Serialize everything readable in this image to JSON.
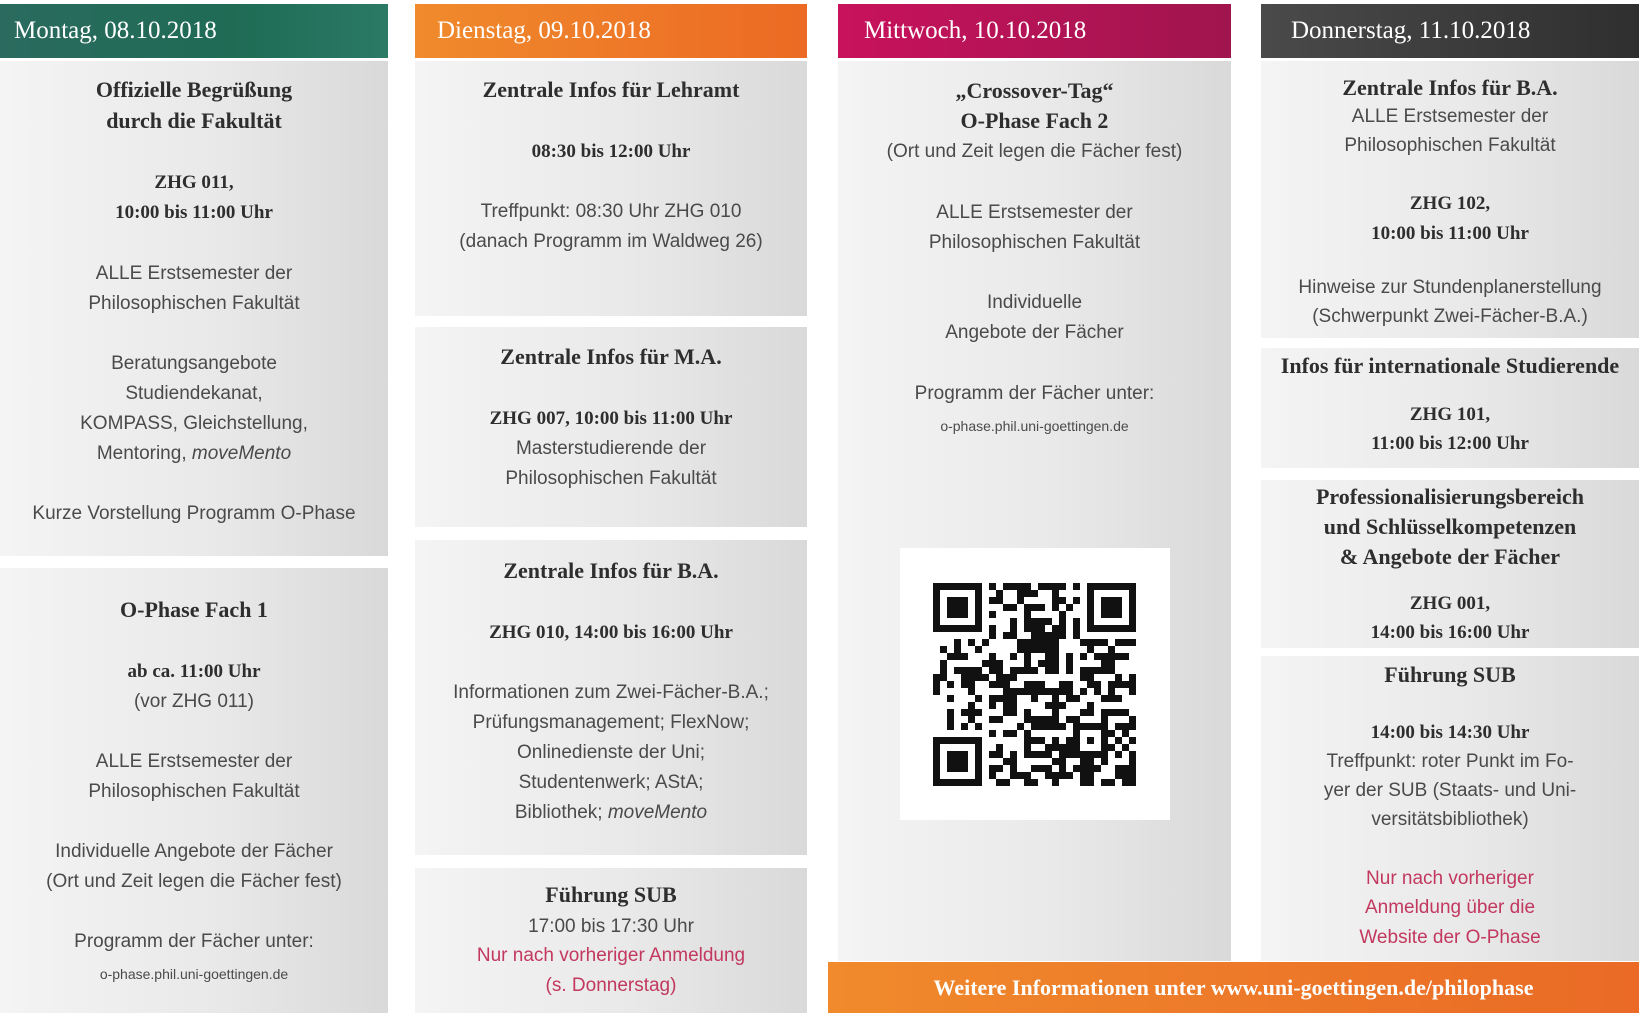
{
  "columns": {
    "mon": {
      "date": "Montag, 08.10.2018",
      "box1": {
        "l1": "Offizielle Begrüßung",
        "l2": "durch die Fakultät",
        "l3": "ZHG 011,",
        "l4": "10:00 bis 11:00 Uhr",
        "l5": "ALLE Erstsemester der",
        "l6": "Philosophischen Fakultät",
        "l7": "Beratungsangebote",
        "l8": "Studiendekanat,",
        "l9": "KOMPASS, Gleichstellung,",
        "l10a": "Mentoring, ",
        "l10b": "moveMento",
        "l11": "Kurze Vorstellung Programm O-Phase"
      },
      "box2": {
        "l1": "O-Phase Fach 1",
        "l2": "ab ca. 11:00 Uhr",
        "l3": "(vor ZHG 011)",
        "l4": "ALLE Erstsemester der",
        "l5": "Philosophischen Fakultät",
        "l6": "Individuelle Angebote der Fächer",
        "l7": "(Ort und Zeit legen die Fächer fest)",
        "l8": "Programm der Fächer unter:",
        "l9": "o-phase.phil.uni-goettingen.de"
      }
    },
    "tue": {
      "date": "Dienstag, 09.10.2018",
      "box1": {
        "l1": "Zentrale Infos für Lehramt",
        "l2": "08:30 bis 12:00 Uhr",
        "l3": "Treffpunkt: 08:30 Uhr ZHG 010",
        "l4": "(danach Programm im Waldweg 26)"
      },
      "box2": {
        "l1": "Zentrale Infos für M.A.",
        "l2": "ZHG 007, 10:00 bis 11:00 Uhr",
        "l3": "Masterstudierende der",
        "l4": "Philosophischen Fakultät"
      },
      "box3": {
        "l1": "Zentrale Infos für B.A.",
        "l2": "ZHG 010, 14:00 bis 16:00 Uhr",
        "l3": "Informationen zum Zwei-Fächer-B.A.;",
        "l4": "Prüfungsmanagement; FlexNow;",
        "l5": "Onlinedienste der Uni;",
        "l6": "Studentenwerk; AStA;",
        "l7a": "Bibliothek; ",
        "l7b": "moveMento"
      },
      "box4": {
        "l1": "Führung SUB",
        "l2": "17:00 bis 17:30 Uhr",
        "l3": "Nur nach vorheriger Anmeldung",
        "l4": "(s. Donnerstag)"
      }
    },
    "wed": {
      "date": "Mittwoch, 10.10.2018",
      "box1": {
        "l1": "„Crossover-Tag“",
        "l2": "O-Phase Fach 2",
        "l3": "(Ort und Zeit legen die Fächer fest)",
        "l4": "ALLE Erstsemester der",
        "l5": "Philosophischen Fakultät",
        "l6": "Individuelle",
        "l7": "Angebote der Fächer",
        "l8": "Programm der Fächer unter:",
        "l9": "o-phase.phil.uni-goettingen.de"
      }
    },
    "thu": {
      "date": "Donnerstag, 11.10.2018",
      "box1": {
        "l1": "Zentrale Infos für B.A.",
        "l2": "ALLE Erstsemester der",
        "l3": "Philosophischen Fakultät",
        "l4": "ZHG 102,",
        "l5": "10:00 bis 11:00 Uhr",
        "l6": "Hinweise zur Stundenplanerstellung",
        "l7": "(Schwerpunkt Zwei-Fächer-B.A.)"
      },
      "box2": {
        "l1": "Infos für internationale Studierende",
        "l2": "ZHG 101,",
        "l3": "11:00 bis 12:00 Uhr"
      },
      "box3": {
        "l1": "Professionalisierungsbereich",
        "l2": "und Schlüsselkompetenzen",
        "l3": "& Angebote der Fächer",
        "l4": "ZHG 001,",
        "l5": "14:00 bis 16:00 Uhr"
      },
      "box4": {
        "l1": "Führung SUB",
        "l2": "14:00 bis 14:30 Uhr",
        "l3": "Treffpunkt: roter Punkt im Fo-",
        "l4": "yer der SUB (Staats- und Uni-",
        "l5": "versitätsbibliothek)",
        "l6": "Nur nach vorheriger",
        "l7": "Anmeldung über die",
        "l8": "Website der O-Phase"
      }
    }
  },
  "qr_code": {
    "icon": "qr-code"
  },
  "footer": "Weitere Informationen unter www.uni-goettingen.de/philophase",
  "colors": {
    "monday": "#2a6b5f",
    "tuesday": "#ec6a24",
    "wednesday": "#b4135a",
    "thursday": "#3a3a3a",
    "highlight": "#c2385f"
  }
}
